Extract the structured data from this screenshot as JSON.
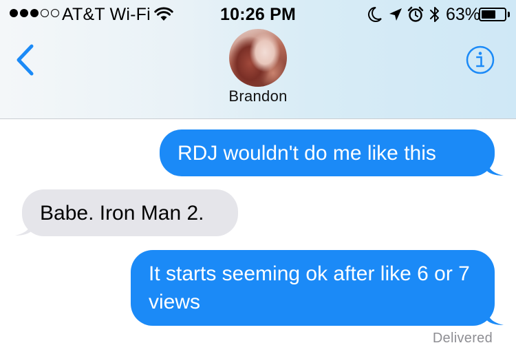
{
  "status_bar": {
    "carrier": "AT&T Wi-Fi",
    "signal_bars_filled": 3,
    "signal_bars_total": 5,
    "time": "10:26 PM",
    "battery_percent": "63%",
    "battery_level": 0.63,
    "icons": [
      "wifi-icon",
      "moon-icon",
      "location-arrow-icon",
      "alarm-icon",
      "bluetooth-icon",
      "battery-icon"
    ]
  },
  "nav": {
    "back_icon": "chevron-left-icon",
    "contact_name": "Brandon",
    "info_icon": "info-icon",
    "accent_color": "#1b8af7"
  },
  "messages": [
    {
      "direction": "outgoing",
      "text": "RDJ wouldn't do me like this"
    },
    {
      "direction": "incoming",
      "text": "Babe. Iron Man 2."
    },
    {
      "direction": "outgoing",
      "text": "It starts seeming ok after like 6 or 7 views"
    }
  ],
  "delivery_status": "Delivered",
  "colors": {
    "outgoing_bubble": "#1b8af7",
    "incoming_bubble": "#e5e5ea",
    "status_text": "#8e8e93"
  }
}
